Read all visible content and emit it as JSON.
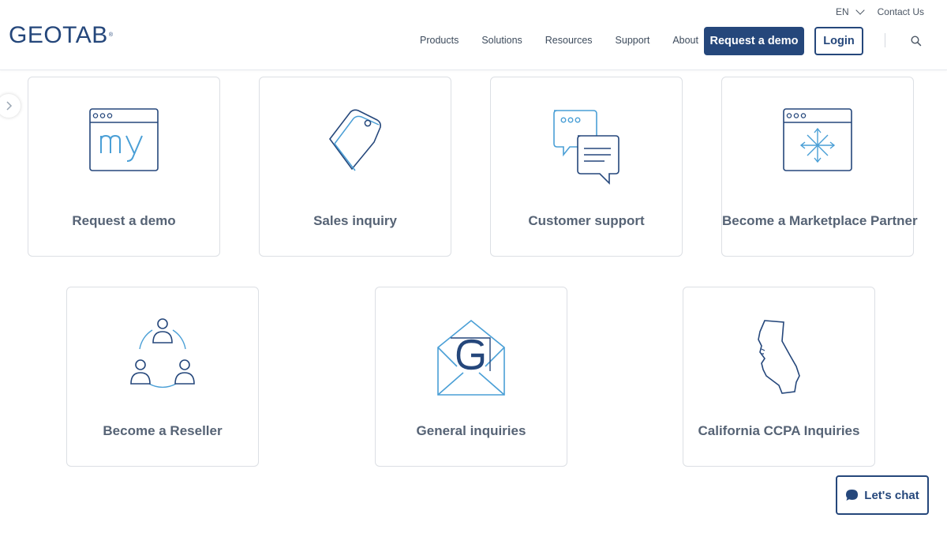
{
  "header": {
    "logo": "GEOTAB",
    "logo_mark": "®",
    "language": "EN",
    "contact": "Contact Us",
    "nav": [
      "Products",
      "Solutions",
      "Resources",
      "Support",
      "About"
    ],
    "request_demo": "Request a demo",
    "login": "Login"
  },
  "cards": [
    {
      "label": "Request a demo",
      "icon": "browser-my-icon"
    },
    {
      "label": "Sales inquiry",
      "icon": "price-tag-icon"
    },
    {
      "label": "Customer support",
      "icon": "chat-bubbles-icon"
    },
    {
      "label": "Become a Marketplace Partner",
      "icon": "browser-arrows-icon"
    },
    {
      "label": "Become a Reseller",
      "icon": "people-network-icon"
    },
    {
      "label": "General inquiries",
      "icon": "envelope-icon"
    },
    {
      "label": "California CCPA Inquiries",
      "icon": "california-map-icon"
    }
  ],
  "chat": {
    "label": "Let's chat"
  },
  "colors": {
    "brand": "#25477b",
    "accent": "#4a9fd6",
    "text": "#566375"
  }
}
